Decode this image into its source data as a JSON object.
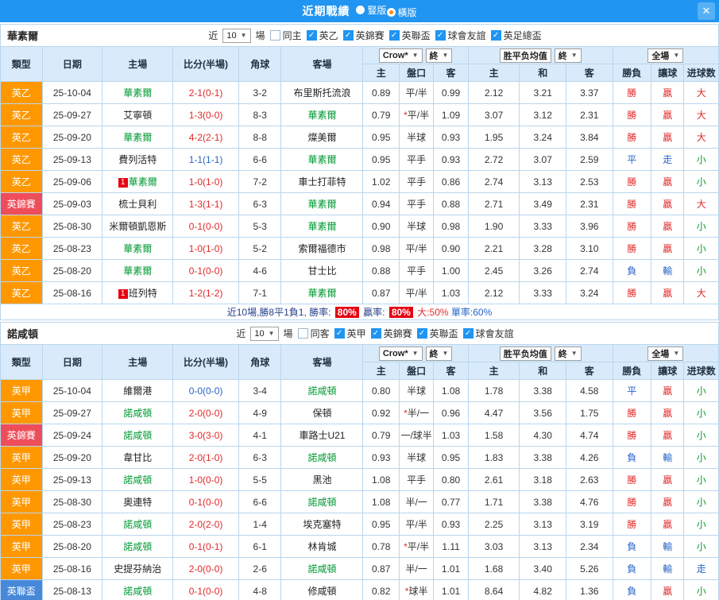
{
  "header": {
    "title": "近期戰績",
    "radios": [
      {
        "label": "豎版",
        "selected": false
      },
      {
        "label": "橫版",
        "selected": true
      }
    ],
    "close": "✕"
  },
  "columns": {
    "type": "類型",
    "date": "日期",
    "home": "主場",
    "score": "比分(半場)",
    "corner": "角球",
    "away": "客場",
    "ah_company": "Crow*",
    "ah_final": "終",
    "ah_sub": [
      "主",
      "盤口",
      "客"
    ],
    "eu_company": "胜平负均值",
    "eu_final": "終",
    "eu_sub": [
      "主",
      "和",
      "客"
    ],
    "result_group": "全場",
    "result_sub": [
      "勝負",
      "讓球",
      "进球数"
    ]
  },
  "tables": [
    {
      "team": "華素爾",
      "filters": {
        "near": "近",
        "count": "10",
        "games": "場",
        "checkboxes": [
          {
            "label": "同主",
            "checked": false
          },
          {
            "label": "英乙",
            "checked": true
          },
          {
            "label": "英錦賽",
            "checked": true
          },
          {
            "label": "英聯盃",
            "checked": true
          },
          {
            "label": "球會友誼",
            "checked": true
          },
          {
            "label": "英足總盃",
            "checked": true
          }
        ]
      },
      "rows": [
        {
          "type": "英乙",
          "type_color": "orange",
          "date": "25-10-04",
          "home": "華素爾",
          "home_focus": true,
          "home_badge": "",
          "score": "2-1(0-1)",
          "score_color": "red",
          "corners": "3-2",
          "away": "布里斯托流浪",
          "away_focus": false,
          "ah_home": "0.89",
          "ah_line": "平/半",
          "ah_away": "0.99",
          "eu_home": "2.12",
          "eu_draw": "3.21",
          "eu_away": "3.37",
          "result": "勝",
          "result_color": "red",
          "handicap_result": "贏",
          "handicap_result_color": "red",
          "goals": "大",
          "goals_color": "red"
        },
        {
          "type": "英乙",
          "type_color": "orange",
          "date": "25-09-27",
          "home": "艾寧頓",
          "home_focus": false,
          "home_badge": "",
          "score": "1-3(0-0)",
          "score_color": "red",
          "corners": "8-3",
          "away": "華素爾",
          "away_focus": true,
          "ah_home": "0.79",
          "ah_line": "*平/半",
          "ah_away": "1.09",
          "eu_home": "3.07",
          "eu_draw": "3.12",
          "eu_away": "2.31",
          "result": "勝",
          "result_color": "red",
          "handicap_result": "贏",
          "handicap_result_color": "red",
          "goals": "大",
          "goals_color": "red"
        },
        {
          "type": "英乙",
          "type_color": "orange",
          "date": "25-09-20",
          "home": "華素爾",
          "home_focus": true,
          "home_badge": "",
          "score": "4-2(2-1)",
          "score_color": "red",
          "corners": "8-8",
          "away": "燦美爾",
          "away_focus": false,
          "ah_home": "0.95",
          "ah_line": "半球",
          "ah_away": "0.93",
          "eu_home": "1.95",
          "eu_draw": "3.24",
          "eu_away": "3.84",
          "result": "勝",
          "result_color": "red",
          "handicap_result": "贏",
          "handicap_result_color": "red",
          "goals": "大",
          "goals_color": "red"
        },
        {
          "type": "英乙",
          "type_color": "orange",
          "date": "25-09-13",
          "home": "費列活特",
          "home_focus": false,
          "home_badge": "",
          "score": "1-1(1-1)",
          "score_color": "blue",
          "corners": "6-6",
          "away": "華素爾",
          "away_focus": true,
          "ah_home": "0.95",
          "ah_line": "平手",
          "ah_away": "0.93",
          "eu_home": "2.72",
          "eu_draw": "3.07",
          "eu_away": "2.59",
          "result": "平",
          "result_color": "blue",
          "handicap_result": "走",
          "handicap_result_color": "blue",
          "goals": "小",
          "goals_color": "green"
        },
        {
          "type": "英乙",
          "type_color": "orange",
          "date": "25-09-06",
          "home": "華素爾",
          "home_focus": true,
          "home_badge": "1",
          "score": "1-0(1-0)",
          "score_color": "red",
          "corners": "7-2",
          "away": "車士打菲特",
          "away_focus": false,
          "ah_home": "1.02",
          "ah_line": "平手",
          "ah_away": "0.86",
          "eu_home": "2.74",
          "eu_draw": "3.13",
          "eu_away": "2.53",
          "result": "勝",
          "result_color": "red",
          "handicap_result": "贏",
          "handicap_result_color": "red",
          "goals": "小",
          "goals_color": "green"
        },
        {
          "type": "英錦賽",
          "type_color": "red",
          "date": "25-09-03",
          "home": "梳士貝利",
          "home_focus": false,
          "home_badge": "",
          "score": "1-3(1-1)",
          "score_color": "red",
          "corners": "6-3",
          "away": "華素爾",
          "away_focus": true,
          "ah_home": "0.94",
          "ah_line": "平手",
          "ah_away": "0.88",
          "eu_home": "2.71",
          "eu_draw": "3.49",
          "eu_away": "2.31",
          "result": "勝",
          "result_color": "red",
          "handicap_result": "贏",
          "handicap_result_color": "red",
          "goals": "大",
          "goals_color": "red"
        },
        {
          "type": "英乙",
          "type_color": "orange",
          "date": "25-08-30",
          "home": "米爾頓凱恩斯",
          "home_focus": false,
          "home_badge": "",
          "score": "0-1(0-0)",
          "score_color": "red",
          "corners": "5-3",
          "away": "華素爾",
          "away_focus": true,
          "ah_home": "0.90",
          "ah_line": "半球",
          "ah_away": "0.98",
          "eu_home": "1.90",
          "eu_draw": "3.33",
          "eu_away": "3.96",
          "result": "勝",
          "result_color": "red",
          "handicap_result": "贏",
          "handicap_result_color": "red",
          "goals": "小",
          "goals_color": "green"
        },
        {
          "type": "英乙",
          "type_color": "orange",
          "date": "25-08-23",
          "home": "華素爾",
          "home_focus": true,
          "home_badge": "",
          "score": "1-0(1-0)",
          "score_color": "red",
          "corners": "5-2",
          "away": "索爾福德市",
          "away_focus": false,
          "ah_home": "0.98",
          "ah_line": "平/半",
          "ah_away": "0.90",
          "eu_home": "2.21",
          "eu_draw": "3.28",
          "eu_away": "3.10",
          "result": "勝",
          "result_color": "red",
          "handicap_result": "贏",
          "handicap_result_color": "red",
          "goals": "小",
          "goals_color": "green"
        },
        {
          "type": "英乙",
          "type_color": "orange",
          "date": "25-08-20",
          "home": "華素爾",
          "home_focus": true,
          "home_badge": "",
          "score": "0-1(0-0)",
          "score_color": "red",
          "corners": "4-6",
          "away": "甘士比",
          "away_focus": false,
          "ah_home": "0.88",
          "ah_line": "平手",
          "ah_away": "1.00",
          "eu_home": "2.45",
          "eu_draw": "3.26",
          "eu_away": "2.74",
          "result": "負",
          "result_color": "blue",
          "handicap_result": "輸",
          "handicap_result_color": "blue",
          "goals": "小",
          "goals_color": "green"
        },
        {
          "type": "英乙",
          "type_color": "orange",
          "date": "25-08-16",
          "home": "班列特",
          "home_focus": false,
          "home_badge": "1",
          "score": "1-2(1-2)",
          "score_color": "red",
          "corners": "7-1",
          "away": "華素爾",
          "away_focus": true,
          "ah_home": "0.87",
          "ah_line": "平/半",
          "ah_away": "1.03",
          "eu_home": "2.12",
          "eu_draw": "3.33",
          "eu_away": "3.24",
          "result": "勝",
          "result_color": "red",
          "handicap_result": "贏",
          "handicap_result_color": "red",
          "goals": "大",
          "goals_color": "red"
        }
      ],
      "summary": {
        "prefix": "近10場,勝8平1負1, 勝率:",
        "win_rate": "80%",
        "mid": "贏率:",
        "cover_rate": "80%",
        "big": "大:50%",
        "odd": "單率:60%"
      }
    },
    {
      "team": "諾咸頓",
      "filters": {
        "near": "近",
        "count": "10",
        "games": "場",
        "checkboxes": [
          {
            "label": "同客",
            "checked": false
          },
          {
            "label": "英甲",
            "checked": true
          },
          {
            "label": "英錦賽",
            "checked": true
          },
          {
            "label": "英聯盃",
            "checked": true
          },
          {
            "label": "球會友誼",
            "checked": true
          }
        ]
      },
      "rows": [
        {
          "type": "英甲",
          "type_color": "orange",
          "date": "25-10-04",
          "home": "維爾港",
          "home_focus": false,
          "home_badge": "",
          "score": "0-0(0-0)",
          "score_color": "blue",
          "corners": "3-4",
          "away": "諾咸頓",
          "away_focus": true,
          "ah_home": "0.80",
          "ah_line": "半球",
          "ah_away": "1.08",
          "eu_home": "1.78",
          "eu_draw": "3.38",
          "eu_away": "4.58",
          "result": "平",
          "result_color": "blue",
          "handicap_result": "贏",
          "handicap_result_color": "red",
          "goals": "小",
          "goals_color": "green"
        },
        {
          "type": "英甲",
          "type_color": "orange",
          "date": "25-09-27",
          "home": "諾咸頓",
          "home_focus": true,
          "home_badge": "",
          "score": "2-0(0-0)",
          "score_color": "red",
          "corners": "4-9",
          "away": "保頓",
          "away_focus": false,
          "ah_home": "0.92",
          "ah_line": "*半/一",
          "ah_away": "0.96",
          "eu_home": "4.47",
          "eu_draw": "3.56",
          "eu_away": "1.75",
          "result": "勝",
          "result_color": "red",
          "handicap_result": "贏",
          "handicap_result_color": "red",
          "goals": "小",
          "goals_color": "green"
        },
        {
          "type": "英錦賽",
          "type_color": "red",
          "date": "25-09-24",
          "home": "諾咸頓",
          "home_focus": true,
          "home_badge": "",
          "score": "3-0(3-0)",
          "score_color": "red",
          "corners": "4-1",
          "away": "車路士U21",
          "away_focus": false,
          "ah_home": "0.79",
          "ah_line": "一/球半",
          "ah_away": "1.03",
          "eu_home": "1.58",
          "eu_draw": "4.30",
          "eu_away": "4.74",
          "result": "勝",
          "result_color": "red",
          "handicap_result": "贏",
          "handicap_result_color": "red",
          "goals": "小",
          "goals_color": "green"
        },
        {
          "type": "英甲",
          "type_color": "orange",
          "date": "25-09-20",
          "home": "韋甘比",
          "home_focus": false,
          "home_badge": "",
          "score": "2-0(1-0)",
          "score_color": "red",
          "corners": "6-3",
          "away": "諾咸頓",
          "away_focus": true,
          "ah_home": "0.93",
          "ah_line": "半球",
          "ah_away": "0.95",
          "eu_home": "1.83",
          "eu_draw": "3.38",
          "eu_away": "4.26",
          "result": "負",
          "result_color": "blue",
          "handicap_result": "輸",
          "handicap_result_color": "blue",
          "goals": "小",
          "goals_color": "green"
        },
        {
          "type": "英甲",
          "type_color": "orange",
          "date": "25-09-13",
          "home": "諾咸頓",
          "home_focus": true,
          "home_badge": "",
          "score": "1-0(0-0)",
          "score_color": "red",
          "corners": "5-5",
          "away": "黑池",
          "away_focus": false,
          "ah_home": "1.08",
          "ah_line": "平手",
          "ah_away": "0.80",
          "eu_home": "2.61",
          "eu_draw": "3.18",
          "eu_away": "2.63",
          "result": "勝",
          "result_color": "red",
          "handicap_result": "贏",
          "handicap_result_color": "red",
          "goals": "小",
          "goals_color": "green"
        },
        {
          "type": "英甲",
          "type_color": "orange",
          "date": "25-08-30",
          "home": "奧連特",
          "home_focus": false,
          "home_badge": "",
          "score": "0-1(0-0)",
          "score_color": "red",
          "corners": "6-6",
          "away": "諾咸頓",
          "away_focus": true,
          "ah_home": "1.08",
          "ah_line": "半/一",
          "ah_away": "0.77",
          "eu_home": "1.71",
          "eu_draw": "3.38",
          "eu_away": "4.76",
          "result": "勝",
          "result_color": "red",
          "handicap_result": "贏",
          "handicap_result_color": "red",
          "goals": "小",
          "goals_color": "green"
        },
        {
          "type": "英甲",
          "type_color": "orange",
          "date": "25-08-23",
          "home": "諾咸頓",
          "home_focus": true,
          "home_badge": "",
          "score": "2-0(2-0)",
          "score_color": "red",
          "corners": "1-4",
          "away": "埃克塞特",
          "away_focus": false,
          "ah_home": "0.95",
          "ah_line": "平/半",
          "ah_away": "0.93",
          "eu_home": "2.25",
          "eu_draw": "3.13",
          "eu_away": "3.19",
          "result": "勝",
          "result_color": "red",
          "handicap_result": "贏",
          "handicap_result_color": "red",
          "goals": "小",
          "goals_color": "green"
        },
        {
          "type": "英甲",
          "type_color": "orange",
          "date": "25-08-20",
          "home": "諾咸頓",
          "home_focus": true,
          "home_badge": "",
          "score": "0-1(0-1)",
          "score_color": "red",
          "corners": "6-1",
          "away": "林肯城",
          "away_focus": false,
          "ah_home": "0.78",
          "ah_line": "*平/半",
          "ah_away": "1.11",
          "eu_home": "3.03",
          "eu_draw": "3.13",
          "eu_away": "2.34",
          "result": "負",
          "result_color": "blue",
          "handicap_result": "輸",
          "handicap_result_color": "blue",
          "goals": "小",
          "goals_color": "green"
        },
        {
          "type": "英甲",
          "type_color": "orange",
          "date": "25-08-16",
          "home": "史提芬納治",
          "home_focus": false,
          "home_badge": "",
          "score": "2-0(0-0)",
          "score_color": "red",
          "corners": "2-6",
          "away": "諾咸頓",
          "away_focus": true,
          "ah_home": "0.87",
          "ah_line": "半/一",
          "ah_away": "1.01",
          "eu_home": "1.68",
          "eu_draw": "3.40",
          "eu_away": "5.26",
          "result": "負",
          "result_color": "blue",
          "handicap_result": "輸",
          "handicap_result_color": "blue",
          "goals": "走",
          "goals_color": "blue"
        },
        {
          "type": "英聯盃",
          "type_color": "blue",
          "date": "25-08-13",
          "home": "諾咸頓",
          "home_focus": true,
          "home_badge": "",
          "score": "0-1(0-0)",
          "score_color": "red",
          "corners": "4-8",
          "away": "修咸頓",
          "away_focus": false,
          "ah_home": "0.82",
          "ah_line": "*球半",
          "ah_away": "1.01",
          "eu_home": "8.64",
          "eu_draw": "4.82",
          "eu_away": "1.36",
          "result": "負",
          "result_color": "blue",
          "handicap_result": "贏",
          "handicap_result_color": "red",
          "goals": "小",
          "goals_color": "green"
        }
      ],
      "summary": null
    }
  ]
}
